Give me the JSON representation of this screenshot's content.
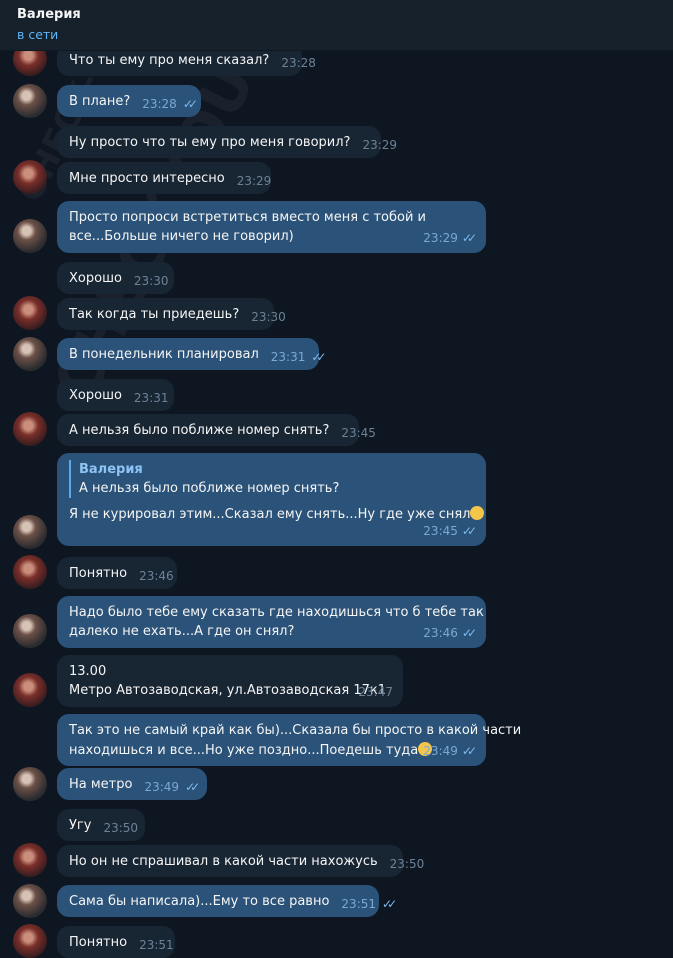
{
  "header": {
    "name": "Валерия",
    "status": "в сети"
  },
  "watermark": {
    "big": "CHECKYOU.ME",
    "small": "CHECK-YOU.ME"
  },
  "messages": [
    {
      "text": "Что ты ему про меня сказал?",
      "time": "23:28"
    },
    {
      "text": "В плане?",
      "time": "23:28"
    },
    {
      "text": "Ну просто что ты ему про меня говорил?",
      "time": "23:29"
    },
    {
      "text": "Мне просто интересно",
      "time": "23:29"
    },
    {
      "line1": "Просто попроси встретиться вместо меня с тобой и",
      "line2": "все...Больше ничего не говорил)",
      "time": "23:29"
    },
    {
      "text": "Хорошо",
      "time": "23:30"
    },
    {
      "text": "Так когда ты приедешь?",
      "time": "23:30"
    },
    {
      "text": "В понедельник планировал",
      "time": "23:31"
    },
    {
      "text": "Хорошо",
      "time": "23:31"
    },
    {
      "text": "А нельзя было поближе номер снять?",
      "time": "23:45"
    },
    {
      "reply_name": "Валерия",
      "reply_text": "А нельзя было поближе номер снять?",
      "text": "Я не курировал этим...Сказал ему снять...Ну где уже снял",
      "time": "23:45"
    },
    {
      "text": "Понятно",
      "time": "23:46"
    },
    {
      "line1": "Надо было тебе ему сказать где находишься что б тебе так",
      "line2": "далеко не ехать...А где он снял?",
      "time": "23:46"
    },
    {
      "line1": "13.00",
      "line2": "Метро Автозаводская, ул.Автозаводская 17к1",
      "time": "23:47"
    },
    {
      "line1": "Так это не самый край как бы)...Сказала бы просто в какой части",
      "line2": "находишься и все...Но уже поздно...Поедешь туда",
      "time": "23:49"
    },
    {
      "text": "На метро",
      "time": "23:49"
    },
    {
      "text": "Угу",
      "time": "23:50"
    },
    {
      "text": "Но он не спрашивал в какой части нахожусь",
      "time": "23:50"
    },
    {
      "text": "Сама бы написала)...Ему то все равно",
      "time": "23:51"
    },
    {
      "text": "Понятно",
      "time": "23:51"
    }
  ]
}
